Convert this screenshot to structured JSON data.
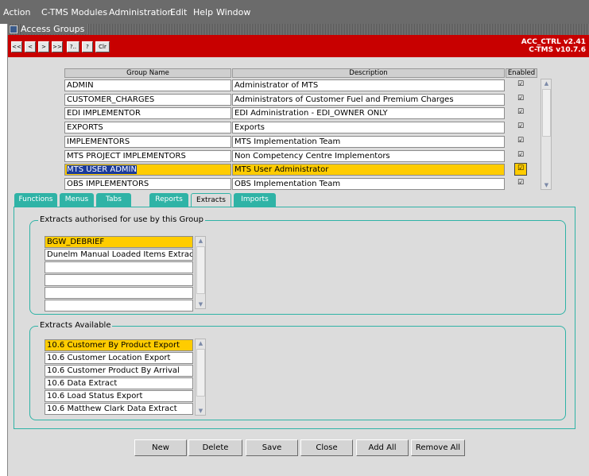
{
  "menu": {
    "items": [
      {
        "label": "Action"
      },
      {
        "label": "C-TMS Modules"
      },
      {
        "label": "Administration"
      },
      {
        "label": "Edit"
      },
      {
        "label": "Help"
      },
      {
        "label": "Window"
      }
    ]
  },
  "window": {
    "title": "Access Groups"
  },
  "toolbar": {
    "first": "<<",
    "prev": "<",
    "next": ">",
    "last": ">>",
    "query": "?..",
    "help": "?",
    "clear": "Clr",
    "version_line1": "ACC_CTRL v2.41",
    "version_line2": "C-TMS v10.7.6"
  },
  "groups_table": {
    "headers": {
      "name": "Group Name",
      "description": "Description",
      "enabled": "Enabled"
    },
    "rows": [
      {
        "name": "ADMIN",
        "description": "Administrator of MTS",
        "enabled": true
      },
      {
        "name": "CUSTOMER_CHARGES",
        "description": "Administrators of Customer Fuel and Premium Charges",
        "enabled": true
      },
      {
        "name": "EDI IMPLEMENTOR",
        "description": "EDI Administration - EDI_OWNER ONLY",
        "enabled": true
      },
      {
        "name": "EXPORTS",
        "description": "Exports",
        "enabled": true
      },
      {
        "name": "IMPLEMENTORS",
        "description": "MTS Implementation Team",
        "enabled": true
      },
      {
        "name": "MTS PROJECT IMPLEMENTORS",
        "description": "Non Competency Centre Implementors",
        "enabled": true
      },
      {
        "name": "MTS USER ADMIN",
        "description": "MTS User Administrator",
        "enabled": true
      },
      {
        "name": "OBS IMPLEMENTORS",
        "description": "OBS Implementation Team",
        "enabled": true
      }
    ],
    "selected_index": 6
  },
  "tabs": {
    "items": [
      {
        "label": "Functions"
      },
      {
        "label": "Menus"
      },
      {
        "label": "Tabs"
      },
      {
        "label": "Reports"
      },
      {
        "label": "Extracts"
      },
      {
        "label": "Imports"
      }
    ],
    "active_index": 4
  },
  "authorised": {
    "label": "Extracts authorised for use by this Group",
    "items": [
      "BGW_DEBRIEF",
      "Dunelm Manual Loaded Items Extract",
      "",
      "",
      "",
      ""
    ]
  },
  "available": {
    "label": "Extracts Available",
    "items": [
      "10.6 Customer By Product Export",
      "10.6 Customer Location Export",
      "10.6 Customer Product By Arrival",
      "10.6 Data Extract",
      "10.6 Load Status Export",
      "10.6 Matthew Clark Data Extract"
    ]
  },
  "buttons": {
    "new": "New",
    "delete": "Delete",
    "save": "Save",
    "close": "Close",
    "add_all": "Add All",
    "remove_all": "Remove All"
  },
  "icons": {
    "check": "☑",
    "up": "▲",
    "down": "▼"
  },
  "colors": {
    "accent_red": "#c80000",
    "selection": "#ffcc00",
    "tab_teal": "#2fb3a6",
    "highlight": "#1a3a9a"
  }
}
